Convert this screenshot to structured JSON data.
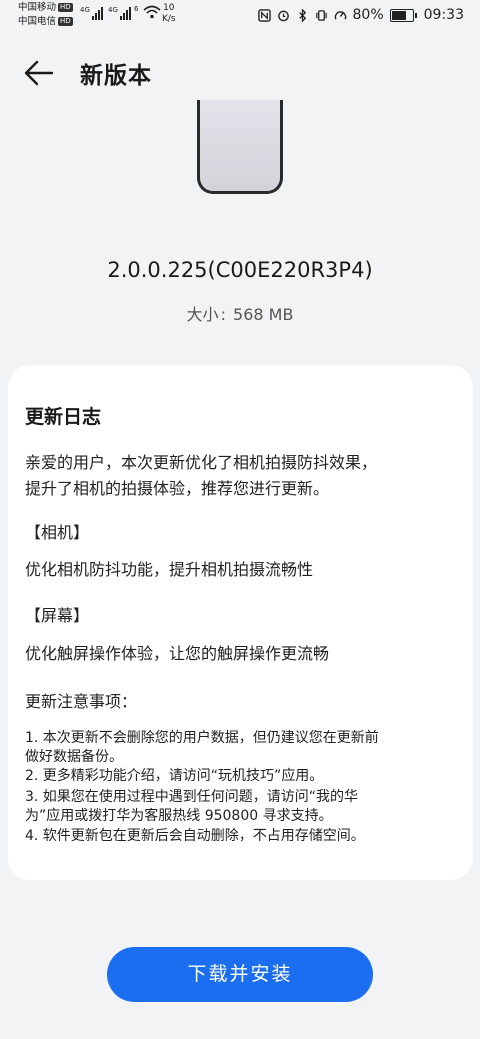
{
  "status_bar": {
    "carrier1": "中国移动",
    "carrier2": "中国电信",
    "hd": "HD",
    "net1": "4G",
    "net2": "4G",
    "net3": "6",
    "speed_value": "10",
    "speed_unit": "K/s",
    "battery": "80%",
    "battery_level": 0.8,
    "time": "09:33"
  },
  "header": {
    "title": "新版本"
  },
  "version": "2.0.0.225(C00E220R3P4)",
  "size": {
    "label": "大小",
    "sep": ":",
    "value": "568 MB"
  },
  "changelog": {
    "title": "更新日志",
    "intro_line1": "亲爱的用户，本次更新优化了相机拍摄防抖效果，",
    "intro_line2": "提升了相机的拍摄体验，推荐您进行更新。",
    "section1_title": "【相机】",
    "section1_text": "优化相机防抖功能，提升相机拍摄流畅性",
    "section2_title": "【屏幕】",
    "section2_text": "优化触屏操作体验，让您的触屏操作更流畅",
    "notes_title": "更新注意事项：",
    "note1_line1": "1. 本次更新不会删除您的用户数据，但仍建议您在更新前",
    "note1_line2": "做好数据备份。",
    "note2": "2. 更多精彩功能介绍，请访问“玩机技巧”应用。",
    "note3_line1": "3. 如果您在使用过程中遇到任何问题，请访问“我的华",
    "note3_line2": "为”应用或拨打华为客服热线 950800 寻求支持。",
    "note4": "4. 软件更新包在更新后会自动删除，不占用存储空间。"
  },
  "install_button": "下载并安装",
  "colors": {
    "accent": "#1b6ef0",
    "background": "#f1f3f5",
    "card": "#ffffff"
  }
}
